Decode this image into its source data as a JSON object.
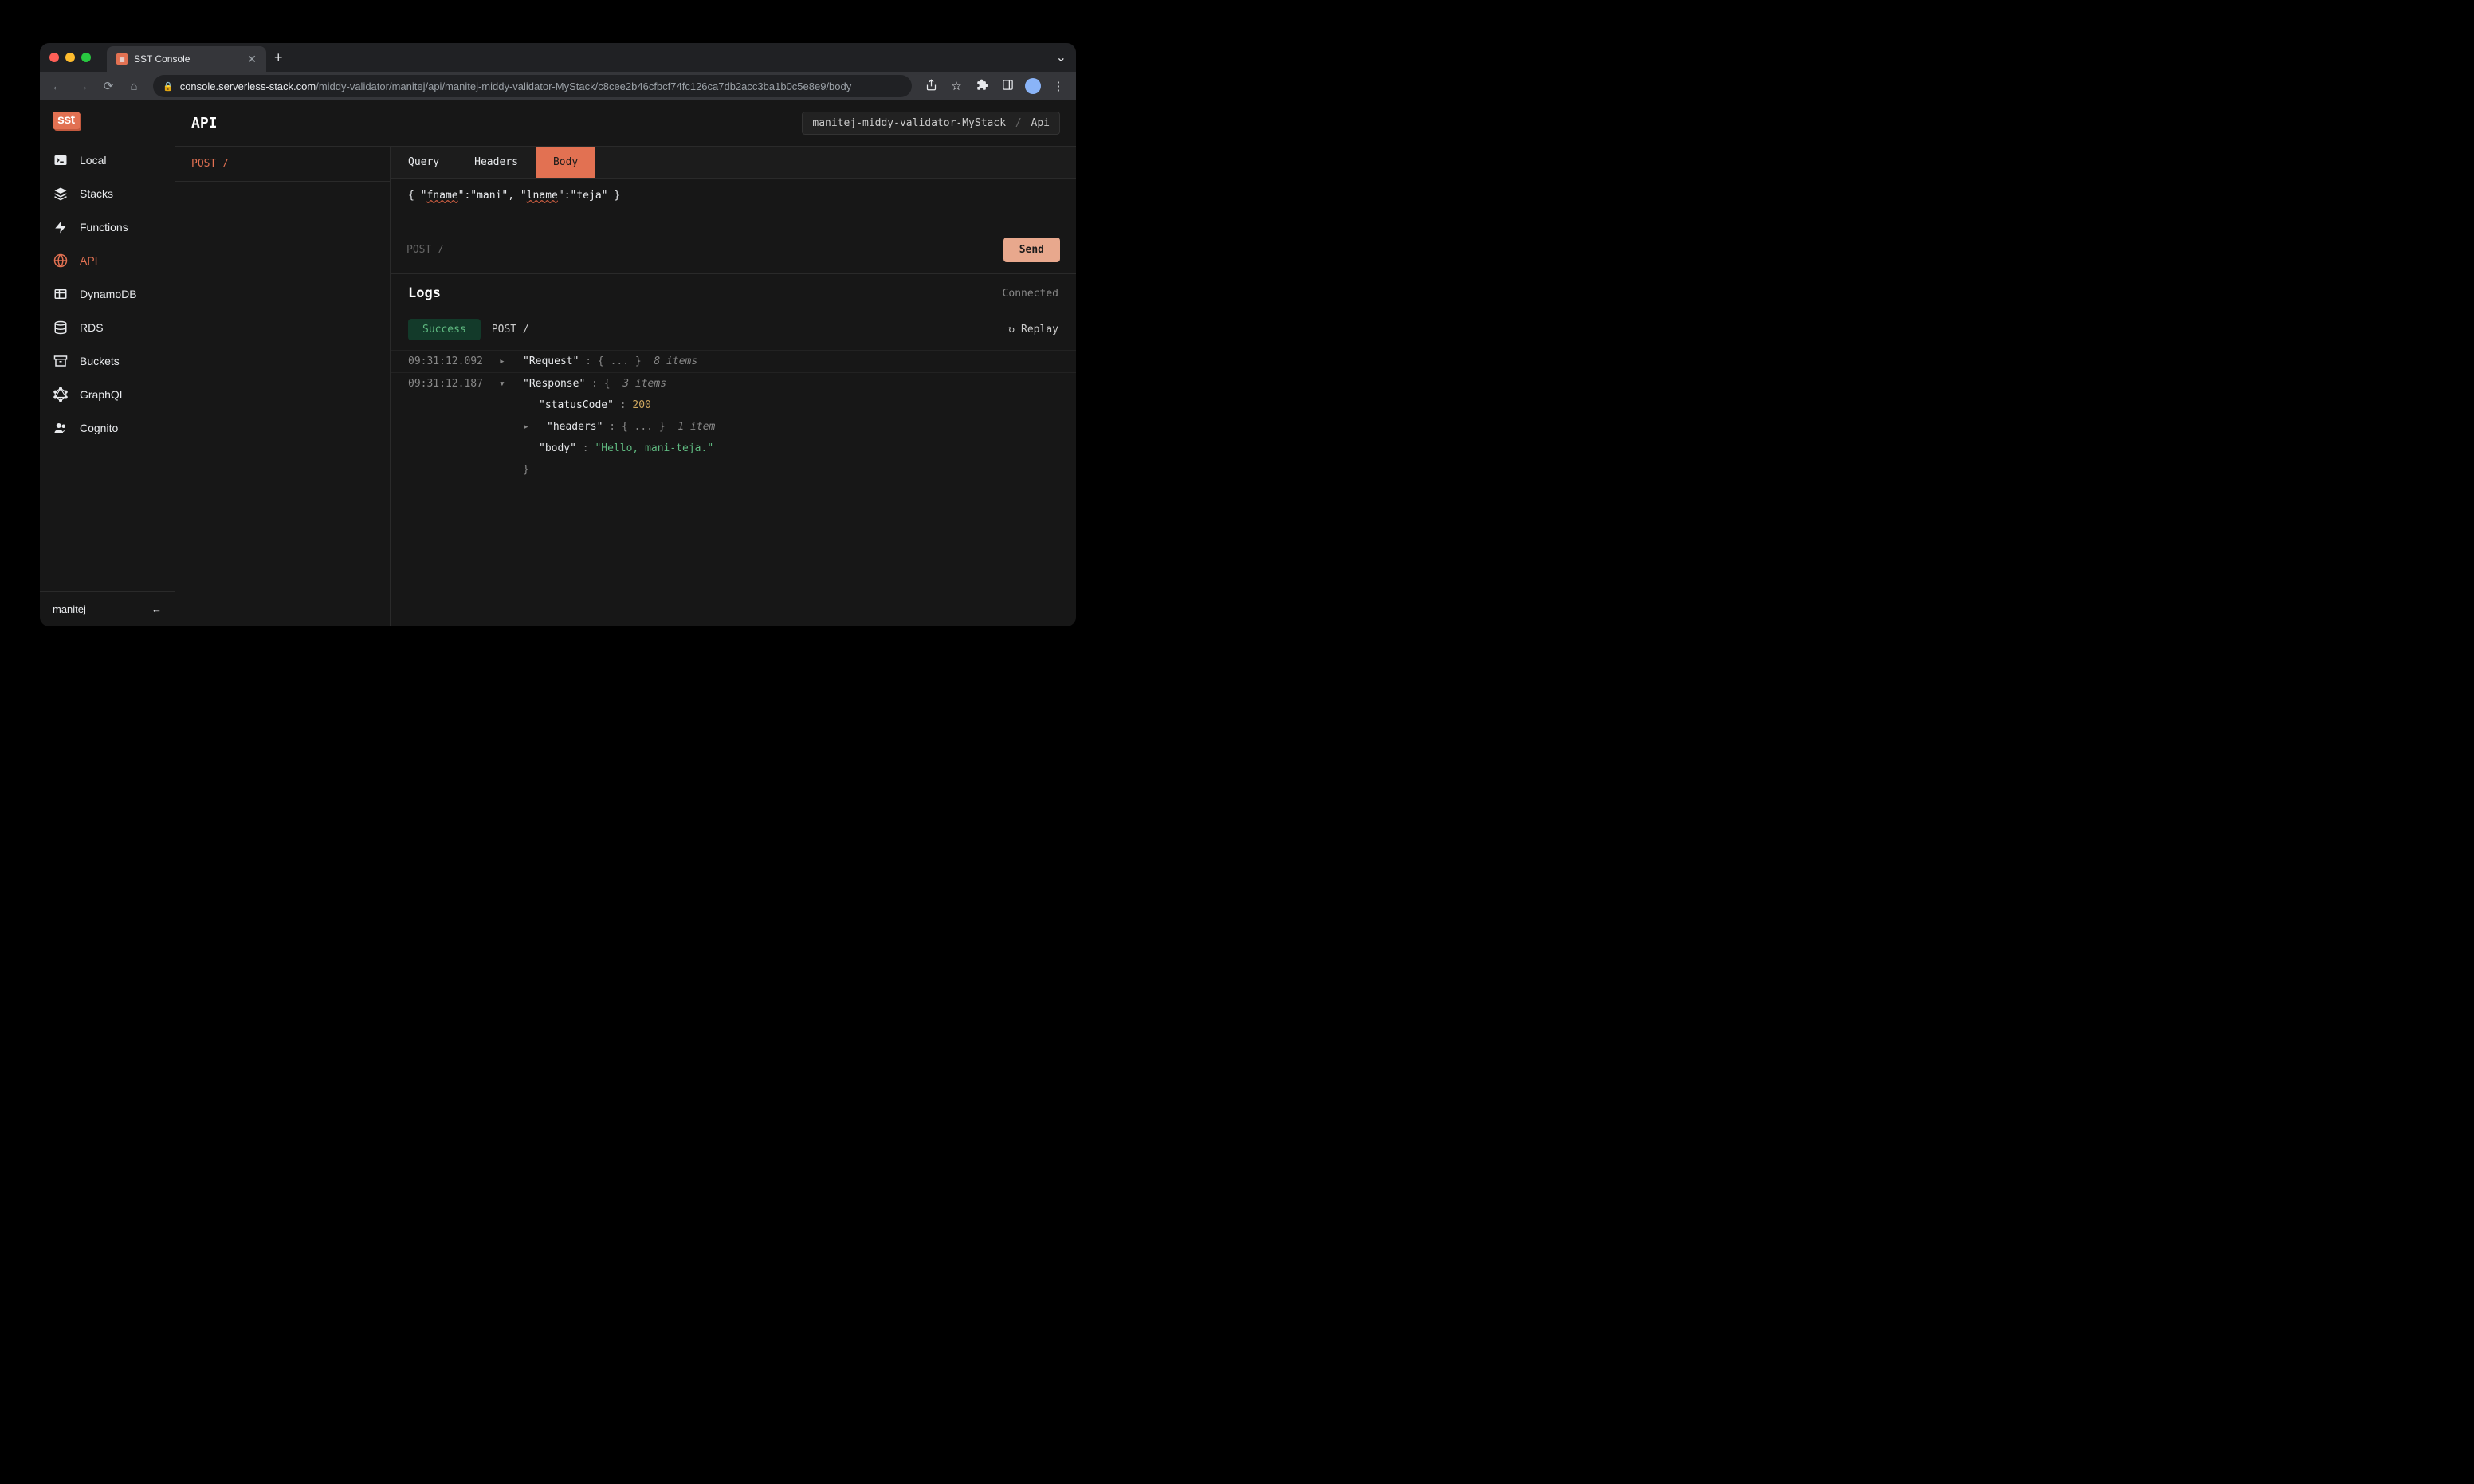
{
  "browser": {
    "tab_title": "SST Console",
    "url_host": "console.serverless-stack.com",
    "url_path": "/middy-validator/manitej/api/manitej-middy-validator-MyStack/c8cee2b46cfbcf74fc126ca7db2acc3ba1b0c5e8e9/body"
  },
  "sidebar": {
    "logo": "sst",
    "items": [
      {
        "label": "Local",
        "icon": "terminal-icon"
      },
      {
        "label": "Stacks",
        "icon": "layers-icon"
      },
      {
        "label": "Functions",
        "icon": "bolt-icon"
      },
      {
        "label": "API",
        "icon": "globe-icon"
      },
      {
        "label": "DynamoDB",
        "icon": "table-icon"
      },
      {
        "label": "RDS",
        "icon": "database-icon"
      },
      {
        "label": "Buckets",
        "icon": "archive-icon"
      },
      {
        "label": "GraphQL",
        "icon": "graphql-icon"
      },
      {
        "label": "Cognito",
        "icon": "users-icon"
      }
    ],
    "footer_user": "manitej"
  },
  "header": {
    "title": "API",
    "breadcrumb_stack": "manitej-middy-validator-MyStack",
    "breadcrumb_resource": "Api"
  },
  "routes": {
    "items": [
      {
        "method": "POST",
        "path": "/"
      }
    ]
  },
  "request": {
    "tabs": [
      "Query",
      "Headers",
      "Body"
    ],
    "active_tab": "Body",
    "body_raw": "{ \"fname\":\"mani\", \"lname\":\"teja\" }",
    "body_keys": [
      "fname",
      "lname"
    ],
    "body_vals": [
      "mani",
      "teja"
    ],
    "send_route": "POST /",
    "send_label": "Send"
  },
  "logs": {
    "title": "Logs",
    "connection": "Connected",
    "status_label": "Success",
    "request_route": "POST /",
    "replay_label": "Replay",
    "entries": [
      {
        "ts": "09:31:12.092",
        "label": "Request",
        "collapsed": true,
        "item_count": "8 items"
      },
      {
        "ts": "09:31:12.187",
        "label": "Response",
        "collapsed": false,
        "item_count": "3 items",
        "statusCode": 200,
        "headers_count": "1 item",
        "body": "\"Hello, mani-teja.\""
      }
    ]
  }
}
